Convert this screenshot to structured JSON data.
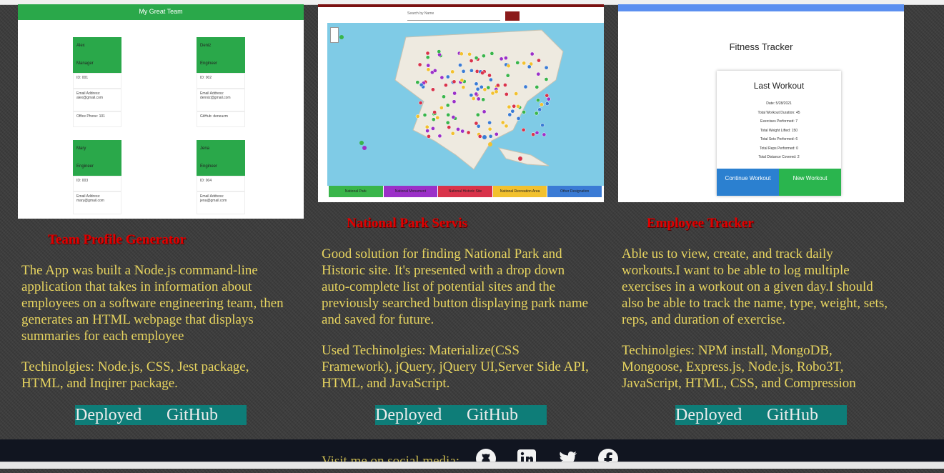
{
  "projects": [
    {
      "title": "Team Profile Generator",
      "description": "The App was built a Node.js command-line application that takes in information about employees on a software engineering team, then generates an HTML webpage that displays summaries for each employee",
      "tech": "Techinolgies: Node.js, CSS, Jest package, HTML, and Inqirer package.",
      "deployed": "Deployed",
      "github": "GitHub",
      "screenshot": {
        "header": "My Great Team",
        "employees": [
          {
            "name": "Alex",
            "role": "Manager",
            "id": "ID: 001",
            "email_label": "Email Address:",
            "email": "alex@gmail.com",
            "extra": "Office Phone: 101"
          },
          {
            "name": "Deniz",
            "role": "Engineer",
            "id": "ID: 002",
            "email_label": "Email Address:",
            "email": "denniz@gmail.com",
            "extra": "GitHub: deneuzm"
          },
          {
            "name": "Mary",
            "role": "Engineer",
            "id": "ID: 003",
            "email_label": "Email Address:",
            "email": "mary@gmail.com",
            "extra": ""
          },
          {
            "name": "Jena",
            "role": "Engineer",
            "id": "ID: 004",
            "email_label": "Email Address:",
            "email": "jena@gmail.com",
            "extra": ""
          }
        ]
      }
    },
    {
      "title": "National Park Servis",
      "description": "Good solution for finding National Park and Historic site. It's presented with a drop down auto-complete list of potential sites and the previously searched button displaying park name and saved for future.",
      "tech": "Used Techinolgies: Materialize(CSS Framework), jQuery, jQuery UI,Server Side API, HTML, and JavaScript.",
      "deployed": "Deployed",
      "github": "GitHub",
      "screenshot": {
        "search_placeholder": "Search by Name",
        "legend": [
          {
            "label": "National Park",
            "color": "#39b54a"
          },
          {
            "label": "National Monument",
            "color": "#9b30c8"
          },
          {
            "label": "National Historic Site",
            "color": "#d9334a"
          },
          {
            "label": "National Recreation Area",
            "color": "#f2c12e"
          },
          {
            "label": "Other Designation",
            "color": "#3a7bd5"
          }
        ]
      }
    },
    {
      "title": "Employee Tracker",
      "description": "Able us to view, create, and track daily workouts.I want to be able to log multiple exercises in a workout on a given day.I should also be able to track the name, type, weight, sets, reps, and duration of exercise.",
      "tech": "Techinolgies: NPM install, MongoDB, Mongoose, Express.js, Node.js, Robo3T, JavaScript, HTML, CSS, and Compression",
      "deployed": "Deployed",
      "github": "GitHub",
      "screenshot": {
        "app_title": "Fitness Tracker",
        "card_title": "Last Workout",
        "lines": [
          "Date: 5/28/2021",
          "Total Workout Duration: 45",
          "Exercises Performed: 7",
          "Total Weight Lifted: 150",
          "Total Sets Performed: 6",
          "Total Reps Performed: 0",
          "Total Distance Covered: 2"
        ],
        "continue_label": "Continue Workout",
        "new_label": "New Workout"
      }
    }
  ],
  "footer": {
    "visit_text": "Visit me on social media:",
    "icons": [
      "github-icon",
      "linkedin-icon",
      "twitter-icon",
      "facebook-icon"
    ]
  },
  "colors": {
    "title": "#e00000",
    "text": "#e7d45f",
    "button_bg": "#0e7d78",
    "footer_bg": "#111520"
  }
}
